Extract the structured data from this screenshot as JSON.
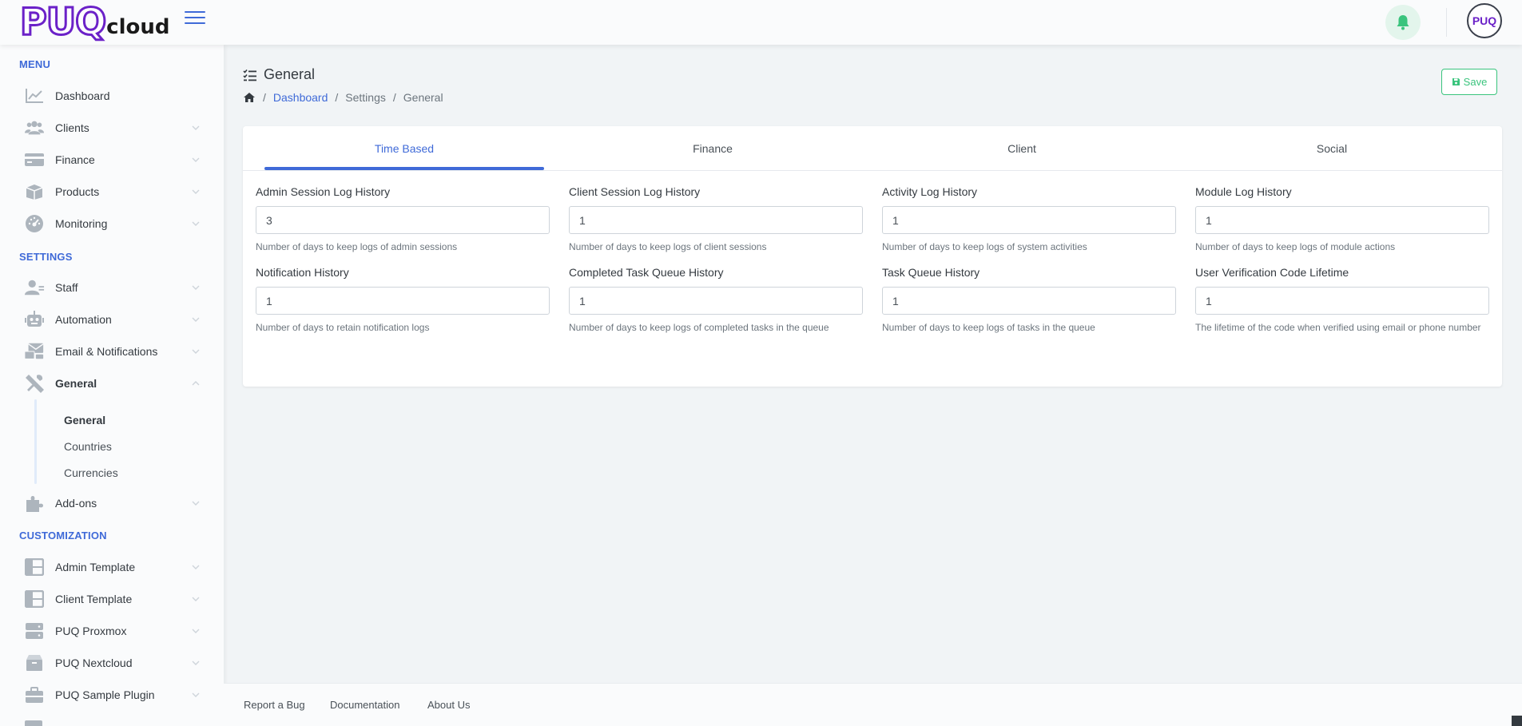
{
  "header": {
    "logo_big": "PUQ",
    "logo_small": "cloud",
    "avatar_text": "PUQ"
  },
  "sidebar": {
    "menu_heading": "MENU",
    "settings_heading": "SETTINGS",
    "customization_heading": "CUSTOMIZATION",
    "menu_items": [
      {
        "label": "Dashboard",
        "icon": "chart-line-icon"
      },
      {
        "label": "Clients",
        "icon": "users-icon"
      },
      {
        "label": "Finance",
        "icon": "credit-card-icon"
      },
      {
        "label": "Products",
        "icon": "box-icon"
      },
      {
        "label": "Monitoring",
        "icon": "gauge-icon"
      }
    ],
    "settings_items": [
      {
        "label": "Staff",
        "icon": "staff-icon"
      },
      {
        "label": "Automation",
        "icon": "robot-icon"
      },
      {
        "label": "Email & Notifications",
        "icon": "mail-bulk-icon"
      },
      {
        "label": "General",
        "icon": "tools-icon"
      }
    ],
    "general_subitems": [
      {
        "label": "General"
      },
      {
        "label": "Countries"
      },
      {
        "label": "Currencies"
      }
    ],
    "addons_label": "Add-ons",
    "customization_items": [
      {
        "label": "Admin Template",
        "icon": "layout-icon"
      },
      {
        "label": "Client Template",
        "icon": "layout-icon"
      },
      {
        "label": "PUQ Proxmox",
        "icon": "server-icon"
      },
      {
        "label": "PUQ Nextcloud",
        "icon": "box-open-icon"
      },
      {
        "label": "PUQ Sample Plugin",
        "icon": "briefcase-icon"
      }
    ]
  },
  "page": {
    "title": "General",
    "breadcrumb": {
      "dashboard": "Dashboard",
      "settings": "Settings",
      "current": "General"
    },
    "save_label": "Save"
  },
  "tabs": [
    {
      "label": "Time Based",
      "active": true
    },
    {
      "label": "Finance",
      "active": false
    },
    {
      "label": "Client",
      "active": false
    },
    {
      "label": "Social",
      "active": false
    }
  ],
  "fields": [
    {
      "label": "Admin Session Log History",
      "value": "3",
      "help": "Number of days to keep logs of admin sessions"
    },
    {
      "label": "Client Session Log History",
      "value": "1",
      "help": "Number of days to keep logs of client sessions"
    },
    {
      "label": "Activity Log History",
      "value": "1",
      "help": "Number of days to keep logs of system activities"
    },
    {
      "label": "Module Log History",
      "value": "1",
      "help": "Number of days to keep logs of module actions"
    },
    {
      "label": "Notification History",
      "value": "1",
      "help": "Number of days to retain notification logs"
    },
    {
      "label": "Completed Task Queue History",
      "value": "1",
      "help": "Number of days to keep logs of completed tasks in the queue"
    },
    {
      "label": "Task Queue History",
      "value": "1",
      "help": "Number of days to keep logs of tasks in the queue"
    },
    {
      "label": "User Verification Code Lifetime",
      "value": "1",
      "help": "The lifetime of the code when verified using email or phone number"
    }
  ],
  "footer": {
    "report_bug": "Report a Bug",
    "documentation": "Documentation",
    "about": "About Us"
  },
  "colors": {
    "accent": "#3f6ad8",
    "success": "#3ac47d",
    "brand": "#6b21c8"
  }
}
